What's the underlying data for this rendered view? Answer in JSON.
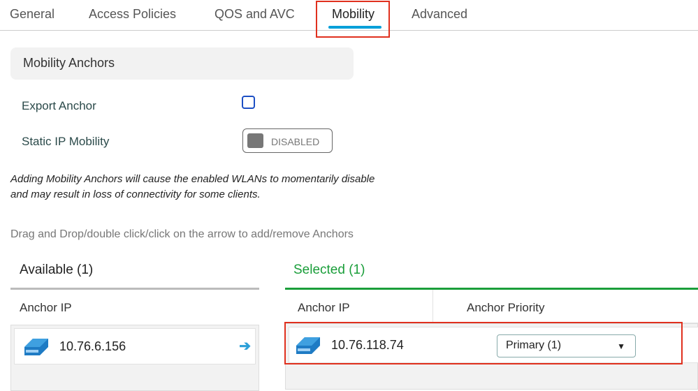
{
  "tabs": [
    {
      "label": "General"
    },
    {
      "label": "Access Policies"
    },
    {
      "label": "QOS and AVC"
    },
    {
      "label": "Mobility"
    },
    {
      "label": "Advanced"
    }
  ],
  "active_tab": "Mobility",
  "section_title": "Mobility Anchors",
  "export_anchor": {
    "label": "Export Anchor",
    "checked": false
  },
  "static_ip": {
    "label": "Static IP Mobility",
    "state": "DISABLED"
  },
  "note": [
    "Adding Mobility Anchors will cause the enabled WLANs to momentarily disable",
    "and may result in loss of connectivity for some clients."
  ],
  "hint": "Drag and Drop/double click/click on the arrow to add/remove Anchors",
  "available": {
    "title": "Available (1)",
    "col": "Anchor IP",
    "rows": [
      {
        "ip": "10.76.6.156"
      }
    ]
  },
  "selected": {
    "title": "Selected (1)",
    "col_ip": "Anchor IP",
    "col_priority": "Anchor Priority",
    "rows": [
      {
        "ip": "10.76.118.74",
        "priority": "Primary (1)"
      }
    ]
  },
  "colors": {
    "accent": "#049fd9",
    "selected_green": "#1a9e3a",
    "highlight": "#e0301e"
  }
}
